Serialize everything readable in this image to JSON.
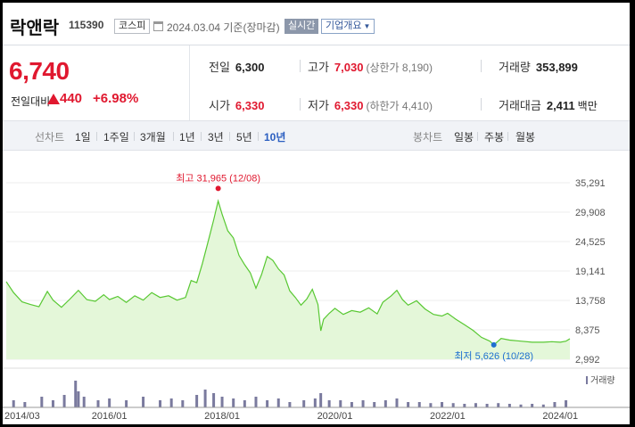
{
  "header": {
    "stock_name": "락앤락",
    "stock_code": "115390",
    "market": "코스피",
    "date": "2024.03.04  기준(장마감)",
    "realtime_button": "실시간",
    "company_button": "기업개요"
  },
  "price": {
    "current": "6,740",
    "change_label": "전일대비",
    "change_amount": "440",
    "change_rate": "+6.98%"
  },
  "stats": {
    "prev_close_label": "전일",
    "prev_close": "6,300",
    "high_label": "고가",
    "high": "7,030",
    "upper_limit": "(상한가 8,190)",
    "volume_label": "거래량",
    "volume": "353,899",
    "open_label": "시가",
    "open": "6,330",
    "low_label": "저가",
    "low": "6,330",
    "lower_limit": "(하한가 4,410)",
    "amount_label": "거래대금",
    "amount": "2,411",
    "amount_unit": "백만"
  },
  "period_tabs": {
    "label": "선차트",
    "items": [
      "1일",
      "1주일",
      "3개월",
      "1년",
      "3년",
      "5년",
      "10년"
    ],
    "active": "10년"
  },
  "candle_tabs": {
    "label": "봉차트",
    "items": [
      "일봉",
      "주봉",
      "월봉"
    ]
  },
  "colors": {
    "up": "#e0182f",
    "low_marker": "#1e6fd0",
    "line": "#58c832",
    "fill": "#e4f7d9",
    "volume": "#7a7a9e",
    "active_tab": "#2a5ec0"
  },
  "chart_data": {
    "type": "area",
    "yticks": [
      "35,291",
      "29,908",
      "24,525",
      "19,141",
      "13,758",
      "8,375",
      "2,992"
    ],
    "ylim": [
      2992,
      35291
    ],
    "xticks": [
      "2014/03",
      "2016/01",
      "2018/01",
      "2020/01",
      "2022/01",
      "2024/01"
    ],
    "max_annotation": {
      "label": "최고 31,965 (12/08)",
      "value": 31965,
      "date": "2017-12-08"
    },
    "min_annotation": {
      "label": "최저 5,626 (10/28)",
      "value": 5626,
      "date": "2022-10-28"
    },
    "volume_label": "거래량",
    "series": [
      {
        "values": [
          [
            2014.17,
            17200
          ],
          [
            2014.3,
            15200
          ],
          [
            2014.45,
            13500
          ],
          [
            2014.6,
            13000
          ],
          [
            2014.75,
            12600
          ],
          [
            2014.9,
            15400
          ],
          [
            2015.0,
            13800
          ],
          [
            2015.15,
            12500
          ],
          [
            2015.3,
            14000
          ],
          [
            2015.45,
            15600
          ],
          [
            2015.6,
            13900
          ],
          [
            2015.75,
            13600
          ],
          [
            2015.9,
            14800
          ],
          [
            2016.0,
            13900
          ],
          [
            2016.15,
            14500
          ],
          [
            2016.3,
            13400
          ],
          [
            2016.45,
            14600
          ],
          [
            2016.6,
            13800
          ],
          [
            2016.75,
            15200
          ],
          [
            2016.9,
            14300
          ],
          [
            2017.05,
            14600
          ],
          [
            2017.2,
            13800
          ],
          [
            2017.35,
            14300
          ],
          [
            2017.45,
            17400
          ],
          [
            2017.55,
            17000
          ],
          [
            2017.65,
            20500
          ],
          [
            2017.75,
            24500
          ],
          [
            2017.85,
            28500
          ],
          [
            2017.93,
            31965
          ],
          [
            2018.0,
            29500
          ],
          [
            2018.1,
            26500
          ],
          [
            2018.2,
            25200
          ],
          [
            2018.3,
            22000
          ],
          [
            2018.4,
            20300
          ],
          [
            2018.5,
            18800
          ],
          [
            2018.6,
            16000
          ],
          [
            2018.7,
            18500
          ],
          [
            2018.8,
            21800
          ],
          [
            2018.9,
            21100
          ],
          [
            2019.0,
            19500
          ],
          [
            2019.1,
            18400
          ],
          [
            2019.2,
            15500
          ],
          [
            2019.3,
            14300
          ],
          [
            2019.4,
            12900
          ],
          [
            2019.5,
            14000
          ],
          [
            2019.6,
            15800
          ],
          [
            2019.7,
            13000
          ],
          [
            2019.75,
            8200
          ],
          [
            2019.8,
            10300
          ],
          [
            2019.9,
            11400
          ],
          [
            2020.0,
            12300
          ],
          [
            2020.15,
            11200
          ],
          [
            2020.3,
            11900
          ],
          [
            2020.45,
            11600
          ],
          [
            2020.6,
            12400
          ],
          [
            2020.75,
            11300
          ],
          [
            2020.85,
            13400
          ],
          [
            2021.0,
            14600
          ],
          [
            2021.1,
            15600
          ],
          [
            2021.2,
            13900
          ],
          [
            2021.3,
            12900
          ],
          [
            2021.45,
            13700
          ],
          [
            2021.6,
            12200
          ],
          [
            2021.75,
            11200
          ],
          [
            2021.9,
            10900
          ],
          [
            2022.0,
            11400
          ],
          [
            2022.15,
            10300
          ],
          [
            2022.3,
            9300
          ],
          [
            2022.45,
            8300
          ],
          [
            2022.6,
            7000
          ],
          [
            2022.75,
            6300
          ],
          [
            2022.82,
            5626
          ],
          [
            2022.95,
            6800
          ],
          [
            2023.1,
            6500
          ],
          [
            2023.3,
            6300
          ],
          [
            2023.5,
            6100
          ],
          [
            2023.7,
            6100
          ],
          [
            2023.85,
            6200
          ],
          [
            2024.0,
            6100
          ],
          [
            2024.1,
            6300
          ],
          [
            2024.17,
            6740
          ]
        ]
      }
    ],
    "volume": [
      [
        2014.3,
        0.2
      ],
      [
        2014.5,
        0.15
      ],
      [
        2014.8,
        0.3
      ],
      [
        2015.0,
        0.2
      ],
      [
        2015.2,
        0.35
      ],
      [
        2015.4,
        0.75
      ],
      [
        2015.45,
        0.45
      ],
      [
        2015.55,
        0.3
      ],
      [
        2015.8,
        0.2
      ],
      [
        2016.0,
        0.25
      ],
      [
        2016.3,
        0.2
      ],
      [
        2016.6,
        0.3
      ],
      [
        2016.9,
        0.2
      ],
      [
        2017.1,
        0.25
      ],
      [
        2017.3,
        0.2
      ],
      [
        2017.55,
        0.35
      ],
      [
        2017.7,
        0.5
      ],
      [
        2017.85,
        0.4
      ],
      [
        2018.0,
        0.3
      ],
      [
        2018.2,
        0.25
      ],
      [
        2018.4,
        0.2
      ],
      [
        2018.6,
        0.3
      ],
      [
        2018.8,
        0.2
      ],
      [
        2019.0,
        0.25
      ],
      [
        2019.2,
        0.15
      ],
      [
        2019.45,
        0.2
      ],
      [
        2019.65,
        0.25
      ],
      [
        2019.75,
        0.4
      ],
      [
        2019.9,
        0.2
      ],
      [
        2020.1,
        0.2
      ],
      [
        2020.3,
        0.15
      ],
      [
        2020.5,
        0.2
      ],
      [
        2020.7,
        0.15
      ],
      [
        2020.9,
        0.2
      ],
      [
        2021.1,
        0.25
      ],
      [
        2021.3,
        0.15
      ],
      [
        2021.5,
        0.15
      ],
      [
        2021.7,
        0.12
      ],
      [
        2021.9,
        0.15
      ],
      [
        2022.1,
        0.12
      ],
      [
        2022.3,
        0.1
      ],
      [
        2022.5,
        0.12
      ],
      [
        2022.7,
        0.1
      ],
      [
        2022.9,
        0.12
      ],
      [
        2023.1,
        0.1
      ],
      [
        2023.3,
        0.08
      ],
      [
        2023.5,
        0.1
      ],
      [
        2023.7,
        0.08
      ],
      [
        2023.9,
        0.15
      ],
      [
        2024.1,
        0.2
      ]
    ]
  }
}
